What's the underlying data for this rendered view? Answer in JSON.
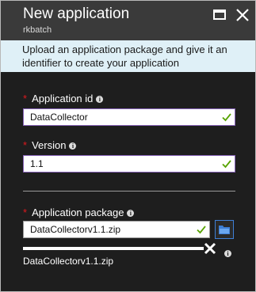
{
  "header": {
    "title": "New application",
    "subtitle": "rkbatch"
  },
  "info_banner": {
    "text": "Upload an application package and give it an identifier to create your application"
  },
  "fields": {
    "application_id": {
      "label": "Application id",
      "value": "DataCollector",
      "required": "*"
    },
    "version": {
      "label": "Version",
      "value": "1.1",
      "required": "*"
    },
    "application_package": {
      "label": "Application package",
      "value": "DataCollectorv1.1.zip",
      "required": "*"
    }
  },
  "upload": {
    "file_name": "DataCollectorv1.1.zip",
    "progress_fraction": 1.0
  },
  "icons": {
    "info": "i",
    "maximize": "maximize-icon",
    "close": "close-icon",
    "check": "check-icon",
    "folder": "folder-icon",
    "cancel": "close-icon"
  },
  "colors": {
    "required": "#e0191e",
    "valid_check": "#57a300",
    "focus_border": "#8764b8",
    "banner_bg": "#dff0f7",
    "browse_accent": "#3e7fd6"
  }
}
